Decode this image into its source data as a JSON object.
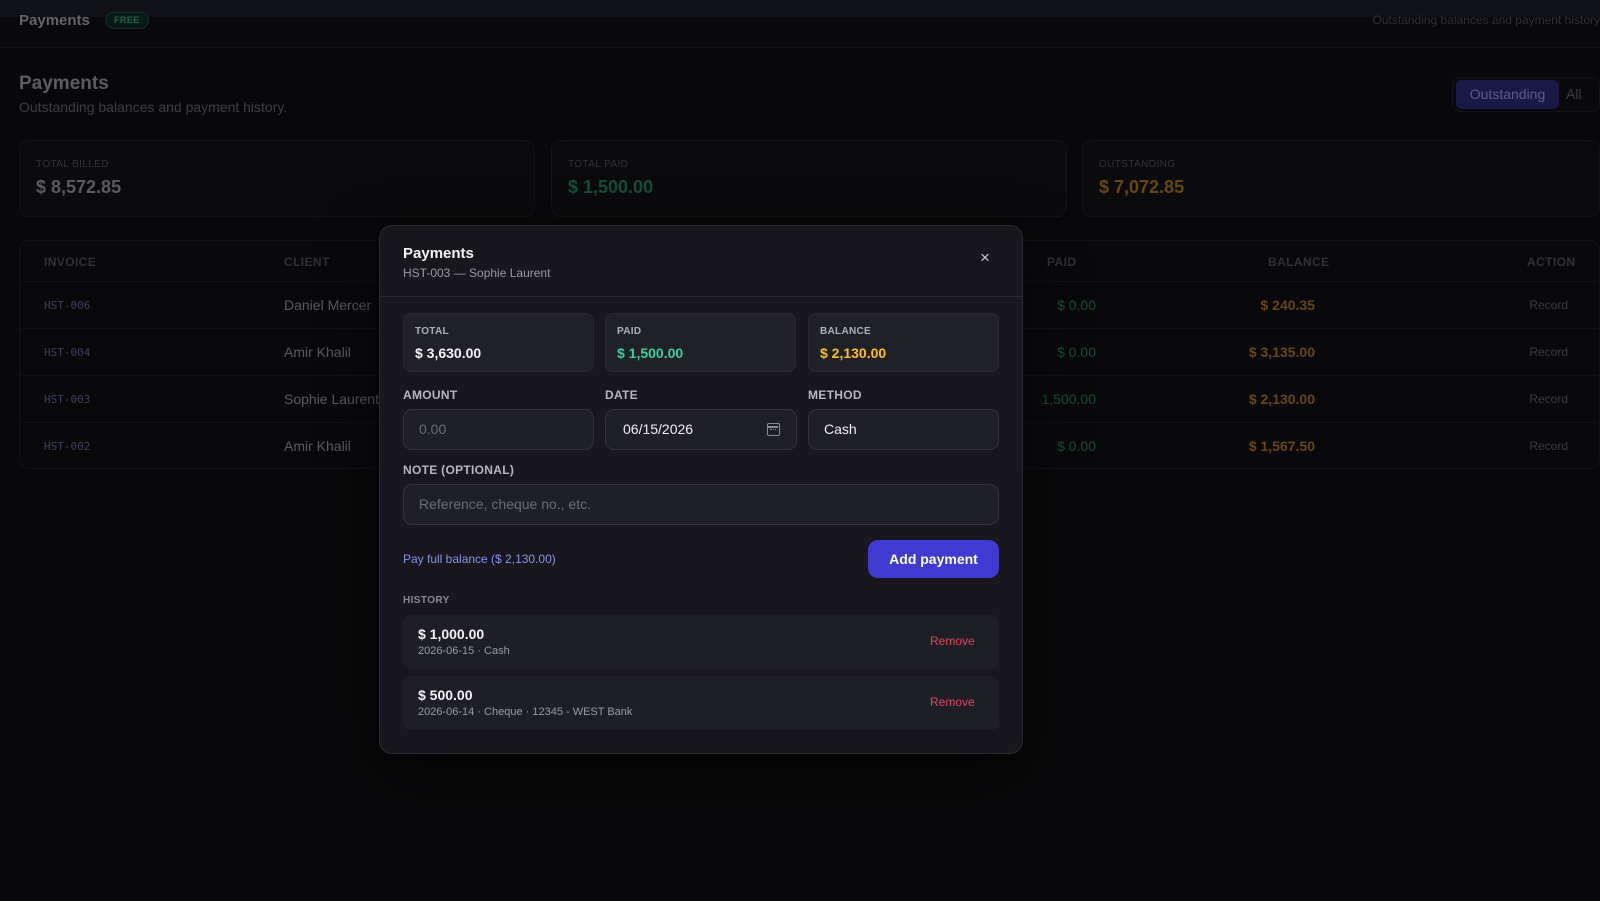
{
  "topbar": {
    "brand": "Payments",
    "badge": "FREE",
    "subtitle": "Outstanding balances and payment history"
  },
  "page": {
    "title": "Payments",
    "subtitle": "Outstanding balances and payment history."
  },
  "filter": {
    "outstanding": "Outstanding",
    "all": "All",
    "active": "Outstanding"
  },
  "stats": {
    "billed": {
      "label": "TOTAL BILLED",
      "value": "$ 8,572.85"
    },
    "paid": {
      "label": "TOTAL PAID",
      "value": "$ 1,500.00"
    },
    "outstanding": {
      "label": "OUTSTANDING",
      "value": "$ 7,072.85"
    }
  },
  "table": {
    "headers": {
      "invoice": "INVOICE",
      "client": "CLIENT",
      "paid": "PAID",
      "balance": "BALANCE",
      "action": "ACTION"
    },
    "rows": [
      {
        "invoice": "HST-006",
        "client": "Daniel Mercer",
        "paid": "$ 0.00",
        "balance": "$ 240.35",
        "action": "Record"
      },
      {
        "invoice": "HST-004",
        "client": "Amir Khalil",
        "paid": "$ 0.00",
        "balance": "$ 3,135.00",
        "action": "Record"
      },
      {
        "invoice": "HST-003",
        "client": "Sophie Laurent",
        "paid": "1,500.00",
        "balance": "$ 2,130.00",
        "action": "Record"
      },
      {
        "invoice": "HST-002",
        "client": "Amir Khalil",
        "paid": "$ 0.00",
        "balance": "$ 1,567.50",
        "action": "Record"
      }
    ]
  },
  "modal": {
    "title": "Payments",
    "subtitle": "HST-003 — Sophie Laurent",
    "close": "×",
    "summary": {
      "total": {
        "label": "TOTAL",
        "value": "$ 3,630.00"
      },
      "paid": {
        "label": "PAID",
        "value": "$ 1,500.00"
      },
      "balance": {
        "label": "BALANCE",
        "value": "$ 2,130.00"
      }
    },
    "form": {
      "amount_label": "AMOUNT",
      "amount_placeholder": "0.00",
      "date_label": "DATE",
      "date_value": "06/15/2026",
      "method_label": "METHOD",
      "method_value": "Cash",
      "note_label": "NOTE (OPTIONAL)",
      "note_placeholder": "Reference, cheque no., etc."
    },
    "pay_full": "Pay full balance ($ 2,130.00)",
    "add_button": "Add payment",
    "history_label": "HISTORY",
    "history": [
      {
        "amount": "$ 1,000.00",
        "meta": "2026-06-15 · Cash",
        "remove": "Remove"
      },
      {
        "amount": "$ 500.00",
        "meta": "2026-06-14 · Cheque · 12345 - WEST Bank",
        "remove": "Remove"
      }
    ]
  },
  "colors": {
    "accent": "#3f3ad1",
    "paid": "#34d399",
    "balance": "#fbbf24",
    "danger": "#e0455c"
  }
}
